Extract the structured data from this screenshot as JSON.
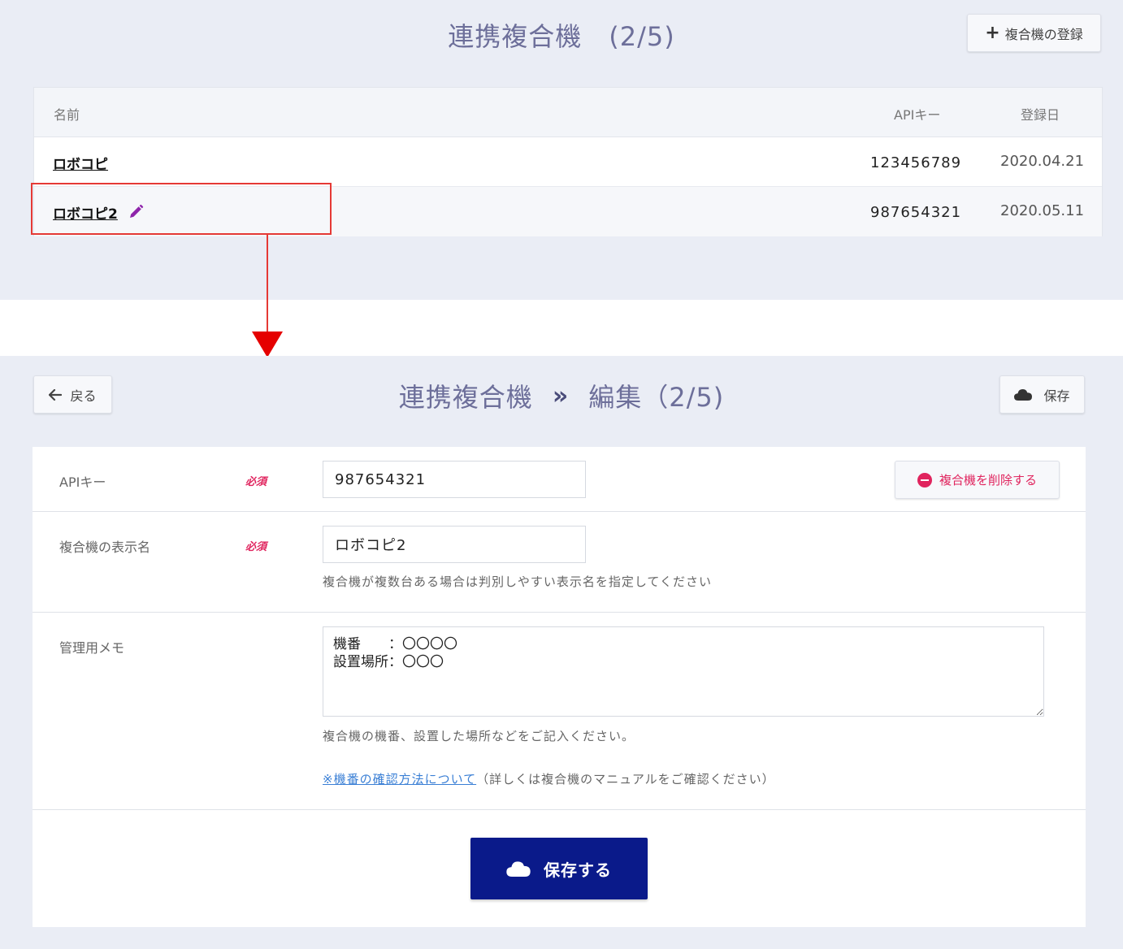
{
  "list": {
    "title": "連携複合機　(2/5)",
    "register_label": "複合機の登録",
    "columns": {
      "name": "名前",
      "api": "APIキー",
      "date": "登録日"
    },
    "rows": [
      {
        "name": "ロボコピ",
        "api": "123456789",
        "date": "2020.04.21"
      },
      {
        "name": "ロボコピ2",
        "api": "987654321",
        "date": "2020.05.11"
      }
    ]
  },
  "edit": {
    "back_label": "戻る",
    "title_left": "連携複合機",
    "title_right": "編集（2/5)",
    "save_top_label": "保存",
    "api_label": "APIキー",
    "required": "必須",
    "api_value": "987654321",
    "delete_label": "複合機を削除する",
    "display_name_label": "複合機の表示名",
    "display_name_value": "ロボコピ2",
    "display_name_help": "複合機が複数台ある場合は判別しやすい表示名を指定してください",
    "memo_label": "管理用メモ",
    "memo_value": "機番　　：〇〇〇〇\n設置場所：〇〇〇",
    "memo_help": "複合機の機番、設置した場所などをご記入ください。",
    "memo_link": "※機番の確認方法について",
    "memo_link_note": "（詳しくは複合機のマニュアルをご確認ください）",
    "save_main_label": "保存する"
  },
  "colors": {
    "accent": "#0a1a8a",
    "required": "#e0245e",
    "highlight": "#e53935",
    "panel_bg": "#eaedf5"
  },
  "icons": [
    "plus-icon",
    "pencil-icon",
    "arrow-left-icon",
    "cloud-icon",
    "minus-circle-icon",
    "chevron-double-right-icon"
  ]
}
